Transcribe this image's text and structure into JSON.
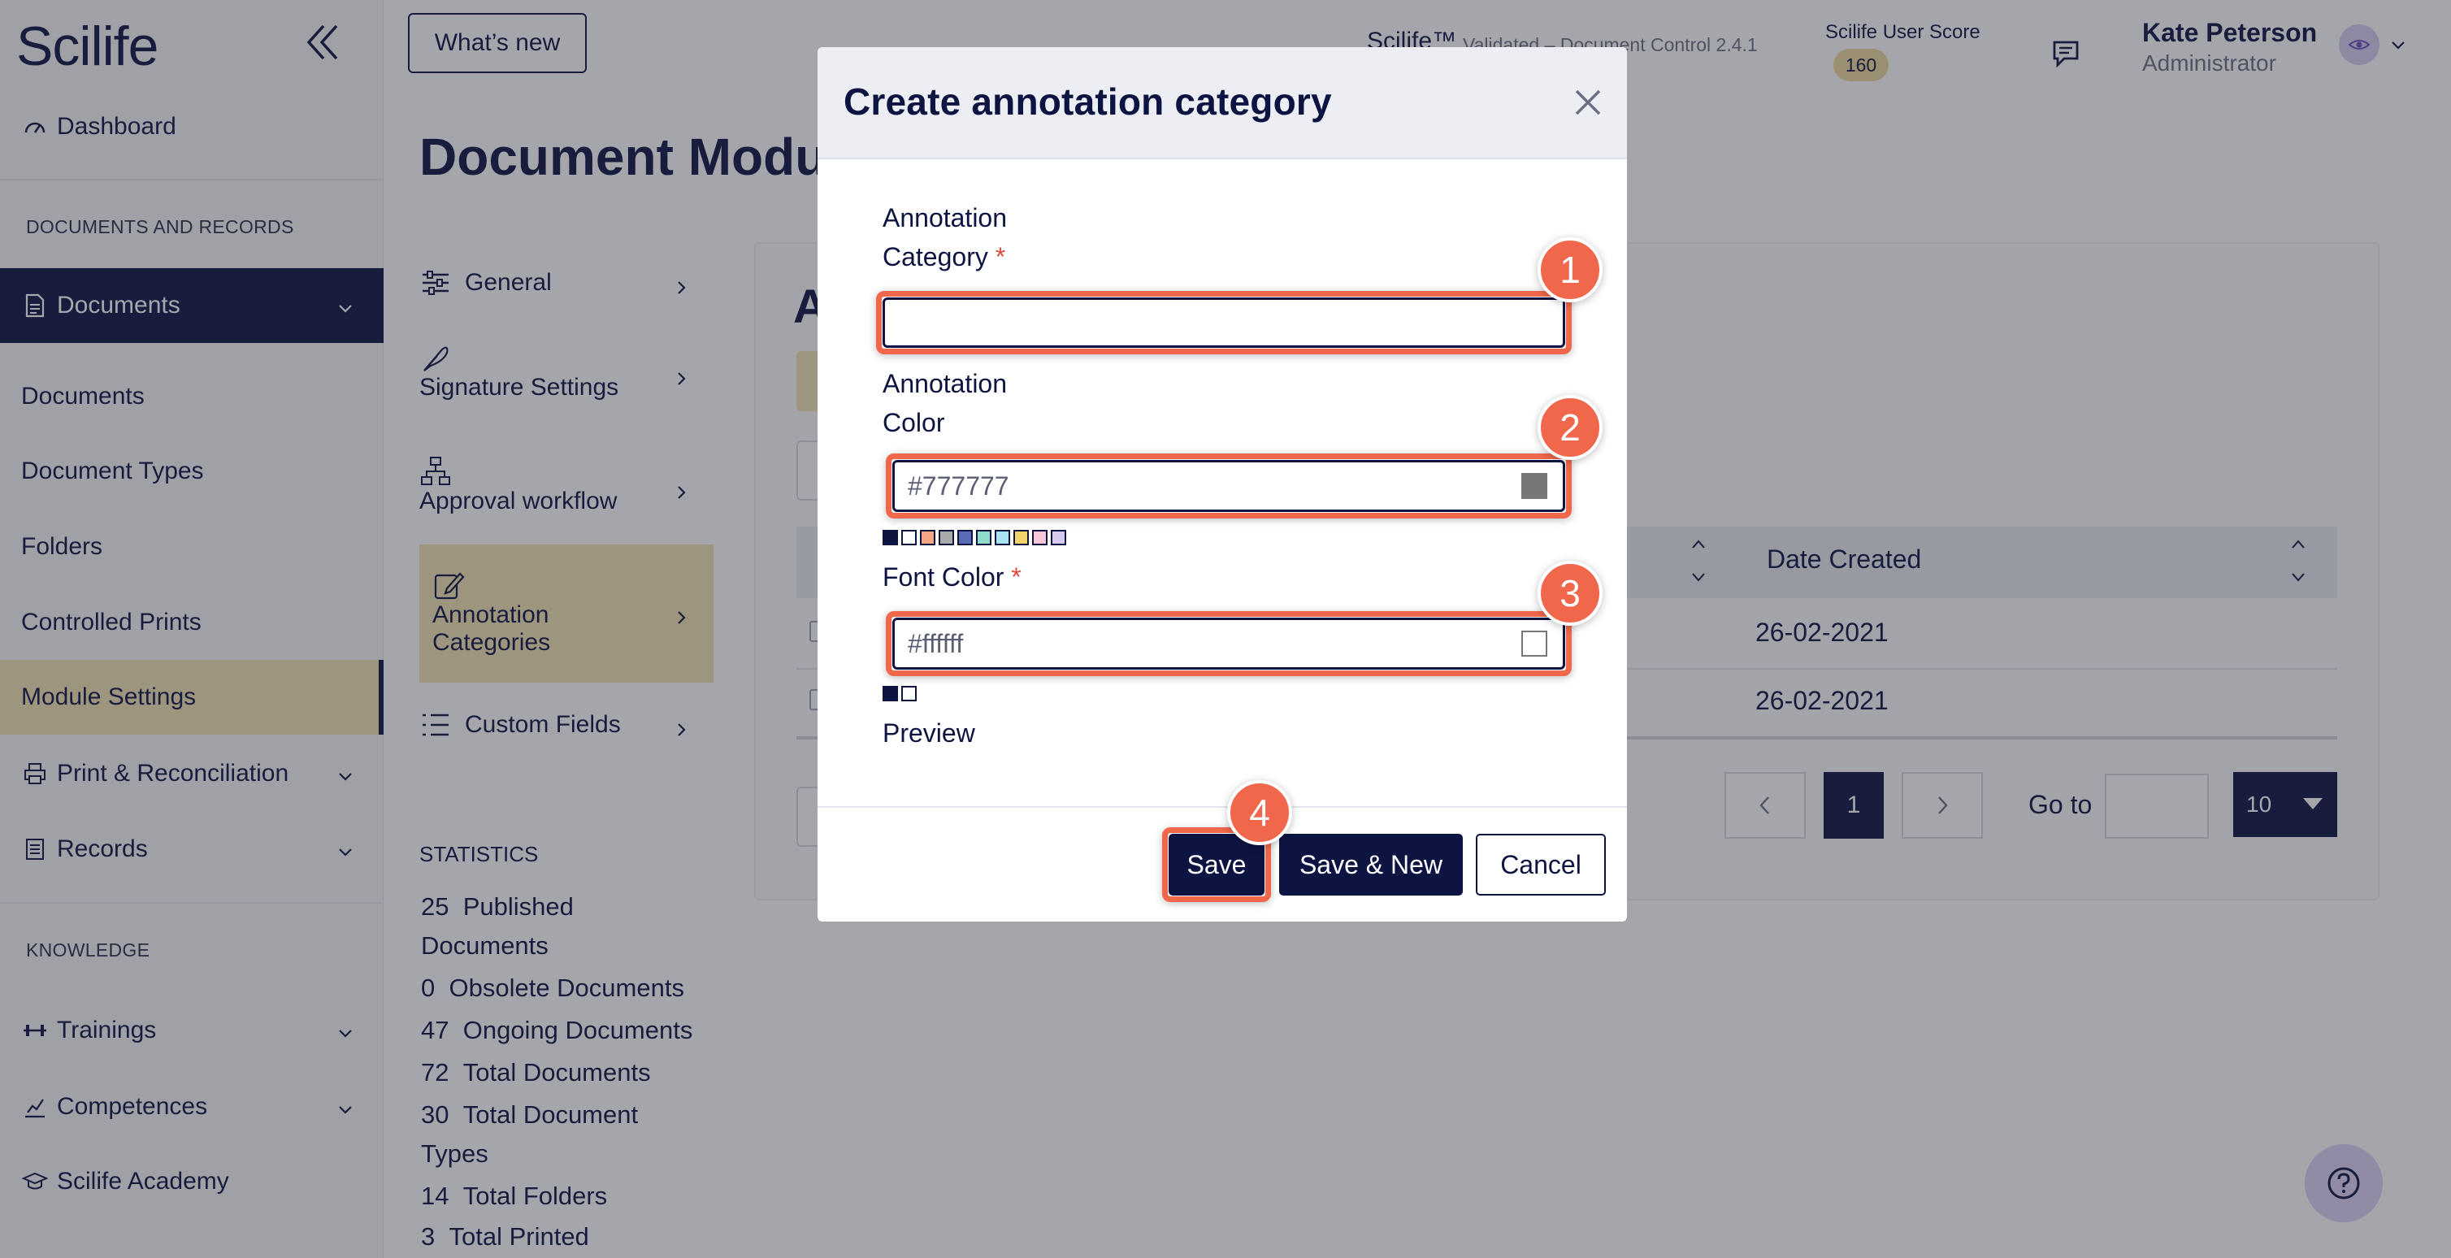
{
  "app": {
    "logo": "Scilife",
    "title": "Scilife™",
    "subtitle": "Validated – Document Control 2.4.1"
  },
  "topbar": {
    "whats_new": "What’s new",
    "score_label": "Scilife User Score",
    "score_value": "160",
    "user_name": "Kate Peterson",
    "user_role": "Administrator"
  },
  "sidebar": {
    "dashboard": "Dashboard",
    "section_documents": "DOCUMENTS AND RECORDS",
    "documents_group": "Documents",
    "items": [
      "Documents",
      "Document Types",
      "Folders",
      "Controlled Prints",
      "Module Settings"
    ],
    "print_reconciliation": "Print & Reconciliation",
    "records": "Records",
    "section_knowledge": "KNOWLEDGE",
    "trainings": "Trainings",
    "competences": "Competences",
    "academy": "Scilife Academy"
  },
  "page": {
    "title": "Document Modu",
    "card_heading": "A",
    "settings": [
      {
        "label": "General"
      },
      {
        "label": "Signature Settings"
      },
      {
        "label": "Approval workflow"
      },
      {
        "label_line1": "Annotation",
        "label_line2": "Categories"
      },
      {
        "label": "Custom Fields"
      }
    ],
    "statistics_title": "STATISTICS",
    "stats": [
      {
        "value": "25",
        "label": "Published",
        "label2": "Documents"
      },
      {
        "value": "0",
        "label": "Obsolete Documents"
      },
      {
        "value": "47",
        "label": "Ongoing Documents"
      },
      {
        "value": "72",
        "label": "Total Documents"
      },
      {
        "value": "30",
        "label": "Total Document",
        "label2": "Types"
      },
      {
        "value": "14",
        "label": "Total Folders"
      },
      {
        "value": "3",
        "label": "Total Printed"
      }
    ],
    "table": {
      "col_date": "Date Created",
      "rows": [
        "26-02-2021",
        "26-02-2021"
      ]
    },
    "pagination": {
      "current": "1",
      "goto_label": "Go to",
      "page_size": "10"
    }
  },
  "modal": {
    "title": "Create annotation category",
    "category_label_1": "Annotation",
    "category_label_2": "Category",
    "category_value": "",
    "color_label_1": "Annotation",
    "color_label_2": "Color",
    "color_value": "#777777",
    "font_color_label": "Font Color",
    "font_color_value": "#ffffff",
    "required_mark": "*",
    "preview_label": "Preview",
    "save": "Save",
    "save_new": "Save & New",
    "cancel": "Cancel",
    "annotation_swatches": [
      "#0e1442",
      "#ffffff",
      "#f4a582",
      "#aaaaaa",
      "#5b6bb5",
      "#8fdcc8",
      "#a9e3f0",
      "#f3d46b",
      "#f7c6d9",
      "#d8c9ef"
    ],
    "font_swatches": [
      "#0e1442",
      "#ffffff"
    ]
  },
  "callouts": [
    "1",
    "2",
    "3",
    "4"
  ],
  "colors": {
    "brand": "#0e1442",
    "accent": "#f3e2b3",
    "callout": "#f0674b"
  }
}
